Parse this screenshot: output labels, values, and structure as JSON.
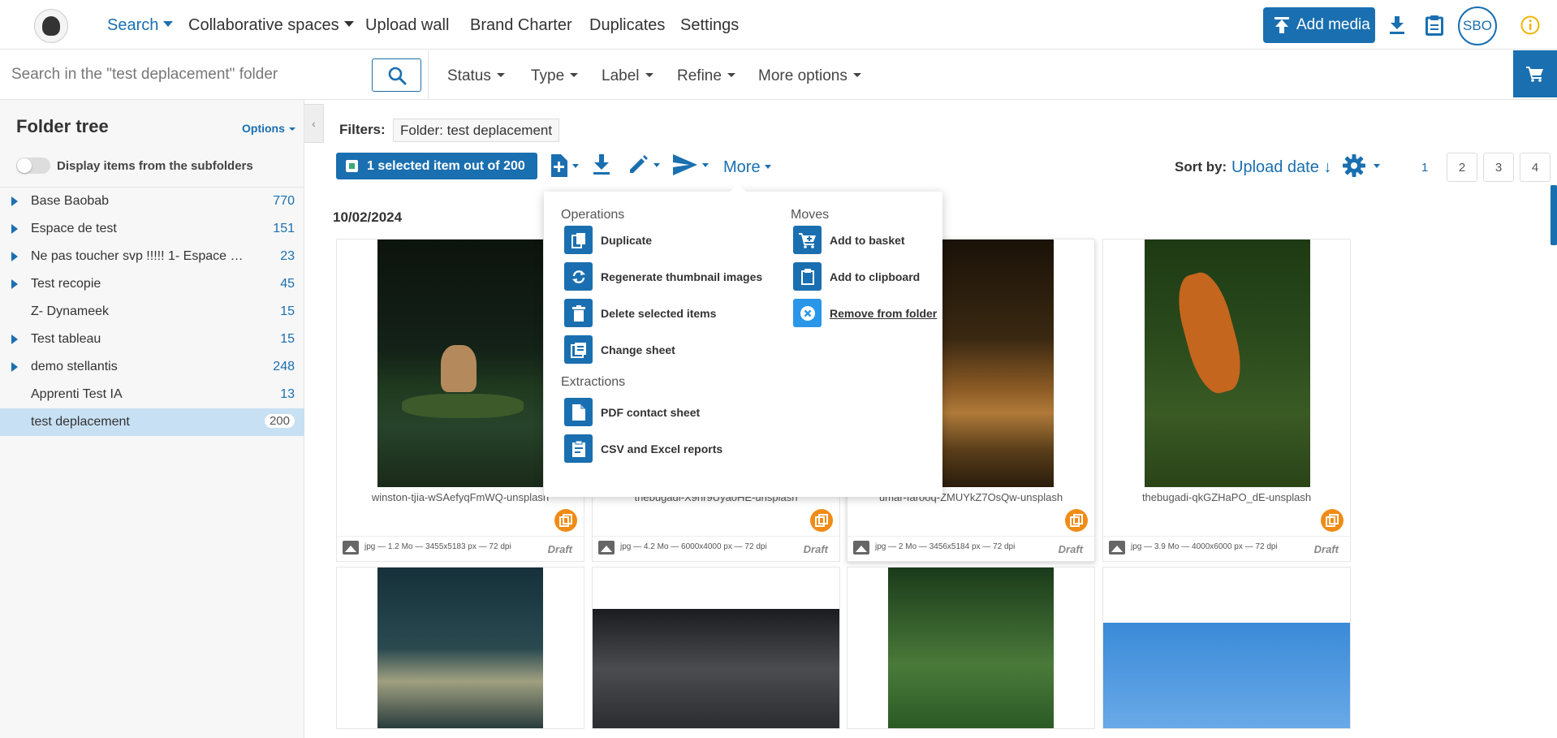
{
  "topnav": {
    "items": [
      {
        "label": "Search",
        "active": true,
        "has_menu": true
      },
      {
        "label": "Collaborative spaces",
        "has_menu": true
      },
      {
        "label": "Upload wall"
      },
      {
        "label": "Brand Charter"
      },
      {
        "label": "Duplicates"
      },
      {
        "label": "Settings"
      }
    ],
    "add_media_label": "Add media",
    "avatar_initials": "SBO"
  },
  "search": {
    "placeholder": "Search in the \"test deplacement\" folder",
    "filters": [
      "Status",
      "Type",
      "Label",
      "Refine",
      "More options"
    ]
  },
  "sidebar": {
    "title": "Folder tree",
    "options_label": "Options",
    "toggle_label": "Display items from the subfolders",
    "folders": [
      {
        "name": "Base Baobab",
        "count": "770",
        "expandable": true
      },
      {
        "name": "Espace de test",
        "count": "151",
        "expandable": true
      },
      {
        "name": "Ne pas toucher svp !!!!! 1- Espace R...",
        "count": "23",
        "expandable": true
      },
      {
        "name": "Test recopie",
        "count": "45",
        "expandable": true
      },
      {
        "name": "Z- Dynameek",
        "count": "15",
        "expandable": false
      },
      {
        "name": "Test tableau",
        "count": "15",
        "expandable": true
      },
      {
        "name": "demo stellantis",
        "count": "248",
        "expandable": true
      },
      {
        "name": "Apprenti Test IA",
        "count": "13",
        "expandable": false
      },
      {
        "name": "test deplacement",
        "count": "200",
        "expandable": false,
        "selected": true
      }
    ]
  },
  "main": {
    "filters_label": "Filters:",
    "filter_chip": "Folder: test deplacement",
    "selection_label": "1 selected item out of 200",
    "more_label": "More",
    "sort_label": "Sort by:",
    "sort_value": "Upload date ↓",
    "pages": [
      "1",
      "2",
      "3",
      "4"
    ],
    "current_page": "1",
    "date_header": "10/02/2024"
  },
  "more_menu": {
    "operations_title": "Operations",
    "operations": [
      "Duplicate",
      "Regenerate thumbnail images",
      "Delete selected items",
      "Change sheet"
    ],
    "extractions_title": "Extractions",
    "extractions": [
      "PDF contact sheet",
      "CSV and Excel reports"
    ],
    "moves_title": "Moves",
    "moves": [
      "Add to basket",
      "Add to clipboard",
      "Remove from folder"
    ]
  },
  "cards": [
    {
      "filename": "winston-tjia-wSAefyqFmWQ-unsplash",
      "meta": "jpg — 1.2 Mo — 3455x5183 px — 72 dpi",
      "status": "Draft"
    },
    {
      "filename": "thebugadi-X9hr9UyaoHE-unsplash",
      "meta": "jpg — 4.2 Mo — 6000x4000 px — 72 dpi",
      "status": "Draft"
    },
    {
      "filename": "umar-farooq-ZMUYkZ7OsQw-unsplash",
      "meta": "jpg — 2 Mo — 3456x5184 px — 72 dpi",
      "status": "Draft"
    },
    {
      "filename": "thebugadi-qkGZHaPO_dE-unsplash",
      "meta": "jpg — 3.9 Mo — 4000x6000 px — 72 dpi",
      "status": "Draft"
    }
  ],
  "colors": {
    "accent": "#1a6fb0",
    "badge": "#f08c16",
    "selected_row": "#c8e0f3"
  }
}
